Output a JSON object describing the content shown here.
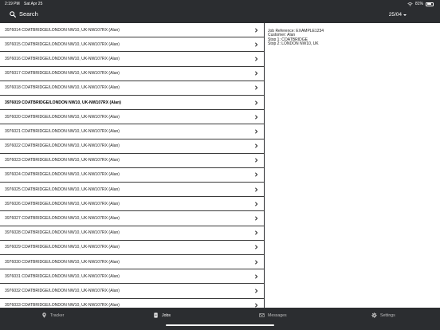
{
  "status_bar": {
    "time": "2:19 PM",
    "date": "Sat Apr 25",
    "battery": "81%",
    "battery_level": 0.81
  },
  "nav": {
    "search_label": "Search",
    "date_label": "25/04"
  },
  "jobs": [
    {
      "label": "3976014 COATBRIDGE/LONDON NW10, UK-NW107RX (Alan)"
    },
    {
      "label": "3976015 COATBRIDGE/LONDON NW10, UK-NW107RX (Alan)"
    },
    {
      "label": "3976016 COATBRIDGE/LONDON NW10, UK-NW107RX (Alan)"
    },
    {
      "label": "3976017 COATBRIDGE/LONDON NW10, UK-NW107RX (Alan)"
    },
    {
      "label": "3976018 COATBRIDGE/LONDON NW10, UK-NW107RX (Alan)"
    },
    {
      "label": "3976019 COATBRIDGE/LONDON NW10, UK-NW107RX (Alan)",
      "selected": true
    },
    {
      "label": "3976020 COATBRIDGE/LONDON NW10, UK-NW107RX (Alan)"
    },
    {
      "label": "3976021 COATBRIDGE/LONDON NW10, UK-NW107RX (Alan)"
    },
    {
      "label": "3976022 COATBRIDGE/LONDON NW10, UK-NW107RX (Alan)"
    },
    {
      "label": "3976023 COATBRIDGE/LONDON NW10, UK-NW107RX (Alan)"
    },
    {
      "label": "3976024 COATBRIDGE/LONDON NW10, UK-NW107RX (Alan)"
    },
    {
      "label": "3976025 COATBRIDGE/LONDON NW10, UK-NW107RX (Alan)"
    },
    {
      "label": "3976026 COATBRIDGE/LONDON NW10, UK-NW107RX (Alan)"
    },
    {
      "label": "3976027 COATBRIDGE/LONDON NW10, UK-NW107RX (Alan)"
    },
    {
      "label": "3976028 COATBRIDGE/LONDON NW10, UK-NW107RX (Alan)"
    },
    {
      "label": "3976029 COATBRIDGE/LONDON NW10, UK-NW107RX (Alan)"
    },
    {
      "label": "3976030 COATBRIDGE/LONDON NW10, UK-NW107RX (Alan)"
    },
    {
      "label": "3976031 COATBRIDGE/LONDON NW10, UK-NW107RX (Alan)"
    },
    {
      "label": "3976032 COATBRIDGE/LONDON NW10, UK-NW107RX (Alan)"
    },
    {
      "label": "3976033 COATBRIDGE/LONDON NW10, UK-NW107RX (Alan)"
    }
  ],
  "detail": {
    "job_reference": "Job Reference: EXAMPLE1234",
    "customer": "Customer: Alan",
    "stop1": "Stop 1: COATBRIDGE",
    "stop2": "Stop 2: LONDON NW10, UK"
  },
  "tabs": {
    "tracker": {
      "label": "Tracker",
      "icon": "map-pin-icon"
    },
    "jobs": {
      "label": "Jobs",
      "icon": "document-icon",
      "active": true
    },
    "messages": {
      "label": "Messages",
      "icon": "envelope-icon"
    },
    "settings": {
      "label": "Settings",
      "icon": "gear-icon"
    }
  },
  "colors": {
    "chrome": "#2b2d30",
    "list_bg": "#ffffff",
    "active_tab": "#ffffff"
  }
}
